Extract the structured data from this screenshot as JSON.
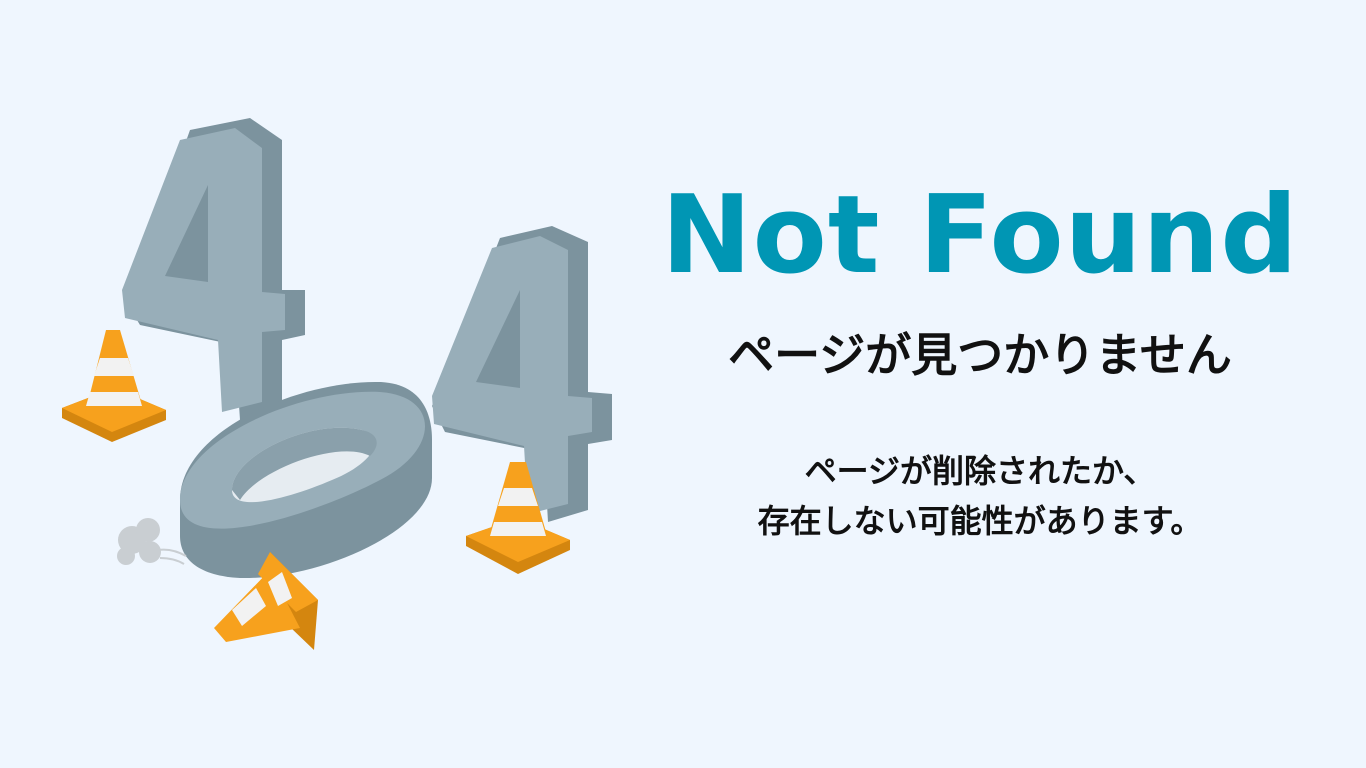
{
  "title": "Not Found",
  "subtitle": "ページが見つかりません",
  "message": {
    "line1": "ページが削除されたか、",
    "line2": "存在しない可能性があります。"
  },
  "illustration": {
    "digits": [
      "4",
      "0",
      "4"
    ],
    "colors": {
      "digit_face": "#98aeb9",
      "digit_side": "#7c939e",
      "cone_orange": "#f7a11d",
      "cone_stripe": "#f2f2f2",
      "title": "#0096b4",
      "background": "#eff6fe"
    }
  }
}
